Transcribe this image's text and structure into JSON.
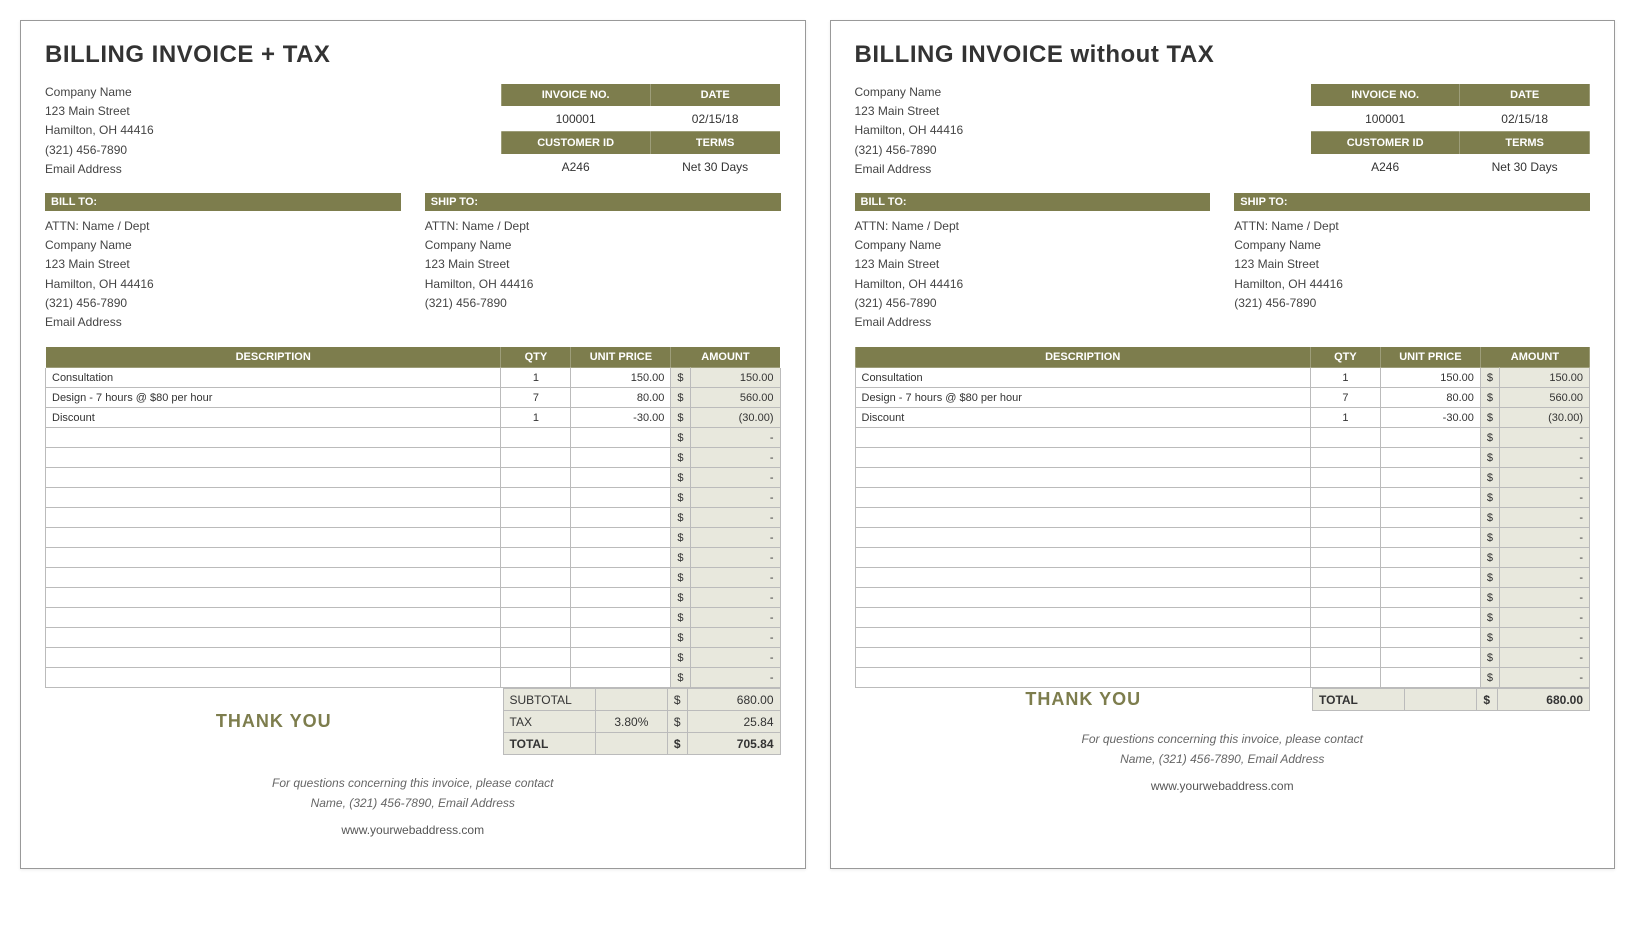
{
  "invoices": [
    {
      "title": "BILLING INVOICE + TAX",
      "company": [
        "Company Name",
        "123 Main Street",
        "Hamilton, OH  44416",
        "(321) 456-7890",
        "Email Address"
      ],
      "meta": {
        "headers1": [
          "INVOICE NO.",
          "DATE"
        ],
        "values1": [
          "100001",
          "02/15/18"
        ],
        "headers2": [
          "CUSTOMER ID",
          "TERMS"
        ],
        "values2": [
          "A246",
          "Net 30 Days"
        ]
      },
      "billto_header": "BILL TO:",
      "billto": [
        "ATTN: Name / Dept",
        "Company Name",
        "123 Main Street",
        "Hamilton, OH  44416",
        "(321) 456-7890",
        "Email Address"
      ],
      "shipto_header": "SHIP TO:",
      "shipto": [
        "ATTN: Name / Dept",
        "Company Name",
        "123 Main Street",
        "Hamilton, OH  44416",
        "(321) 456-7890"
      ],
      "item_headers": [
        "DESCRIPTION",
        "QTY",
        "UNIT PRICE",
        "AMOUNT"
      ],
      "items": [
        {
          "desc": "Consultation",
          "qty": "1",
          "unit": "150.00",
          "amt": "150.00"
        },
        {
          "desc": "Design - 7 hours @ $80 per hour",
          "qty": "7",
          "unit": "80.00",
          "amt": "560.00"
        },
        {
          "desc": "Discount",
          "qty": "1",
          "unit": "-30.00",
          "amt": "(30.00)"
        }
      ],
      "blank_rows": 13,
      "currency": "$",
      "dash": "-",
      "thankyou": "THANK YOU",
      "summary": [
        {
          "label": "SUBTOTAL",
          "mid": "",
          "sym": "$",
          "val": "680.00",
          "bold": false
        },
        {
          "label": "TAX",
          "mid": "3.80%",
          "sym": "$",
          "val": "25.84",
          "bold": false
        },
        {
          "label": "TOTAL",
          "mid": "",
          "sym": "$",
          "val": "705.84",
          "bold": true
        }
      ],
      "footer": {
        "line1": "For questions concerning this invoice, please contact",
        "line2": "Name, (321) 456-7890, Email Address",
        "web": "www.yourwebaddress.com"
      }
    },
    {
      "title": "BILLING INVOICE without TAX",
      "company": [
        "Company Name",
        "123 Main Street",
        "Hamilton, OH  44416",
        "(321) 456-7890",
        "Email Address"
      ],
      "meta": {
        "headers1": [
          "INVOICE NO.",
          "DATE"
        ],
        "values1": [
          "100001",
          "02/15/18"
        ],
        "headers2": [
          "CUSTOMER ID",
          "TERMS"
        ],
        "values2": [
          "A246",
          "Net 30 Days"
        ]
      },
      "billto_header": "BILL TO:",
      "billto": [
        "ATTN: Name / Dept",
        "Company Name",
        "123 Main Street",
        "Hamilton, OH  44416",
        "(321) 456-7890",
        "Email Address"
      ],
      "shipto_header": "SHIP TO:",
      "shipto": [
        "ATTN: Name / Dept",
        "Company Name",
        "123 Main Street",
        "Hamilton, OH  44416",
        "(321) 456-7890"
      ],
      "item_headers": [
        "DESCRIPTION",
        "QTY",
        "UNIT PRICE",
        "AMOUNT"
      ],
      "items": [
        {
          "desc": "Consultation",
          "qty": "1",
          "unit": "150.00",
          "amt": "150.00"
        },
        {
          "desc": "Design - 7 hours @ $80 per hour",
          "qty": "7",
          "unit": "80.00",
          "amt": "560.00"
        },
        {
          "desc": "Discount",
          "qty": "1",
          "unit": "-30.00",
          "amt": "(30.00)"
        }
      ],
      "blank_rows": 13,
      "currency": "$",
      "dash": "-",
      "thankyou": "THANK YOU",
      "summary": [
        {
          "label": "TOTAL",
          "mid": "",
          "sym": "$",
          "val": "680.00",
          "bold": true
        }
      ],
      "footer": {
        "line1": "For questions concerning this invoice, please contact",
        "line2": "Name, (321) 456-7890, Email Address",
        "web": "www.yourwebaddress.com"
      }
    }
  ]
}
